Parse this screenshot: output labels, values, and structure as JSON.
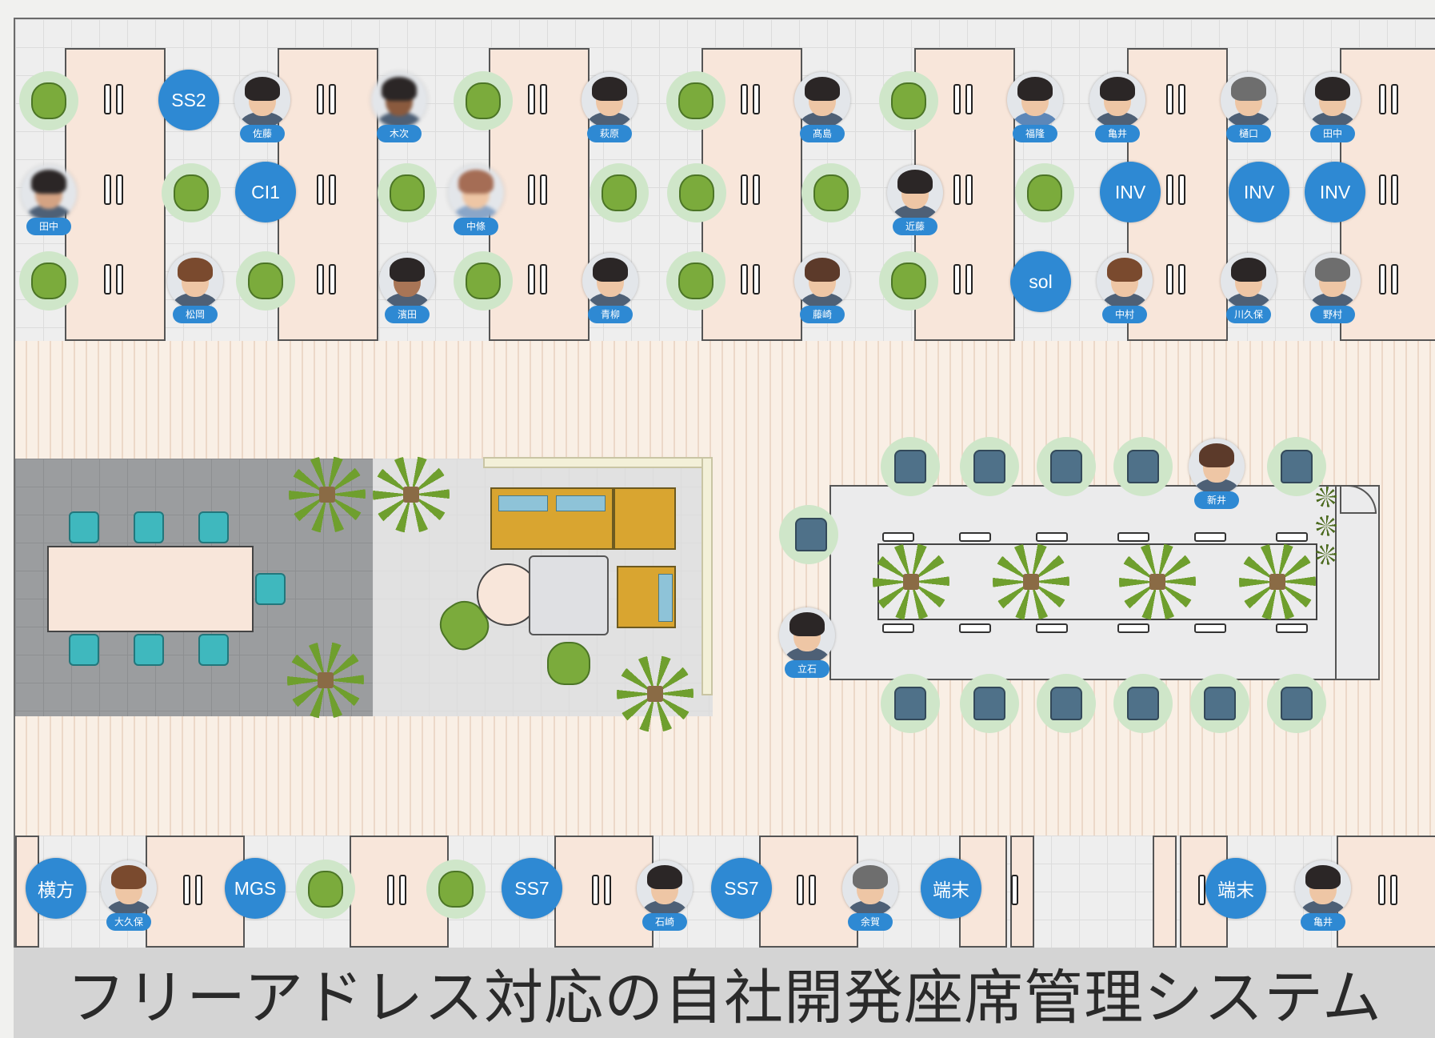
{
  "caption": "フリーアドレス対応の自社開発座席管理システム",
  "colors": {
    "badge": "#2e89d3",
    "desk": "#f8e6da",
    "vacant_seat": "#7bab3c",
    "floor": "#f7ece2"
  },
  "top_row": {
    "seats": [
      {
        "row": 0,
        "kind": "vacant"
      },
      {
        "row": 0,
        "kind": "badge",
        "label": "SS2"
      },
      {
        "row": 0,
        "kind": "person",
        "name": "佐藤"
      },
      {
        "row": 0,
        "kind": "person",
        "name": "木次"
      },
      {
        "row": 0,
        "kind": "vacant"
      },
      {
        "row": 0,
        "kind": "person",
        "name": "萩原"
      },
      {
        "row": 0,
        "kind": "vacant"
      },
      {
        "row": 0,
        "kind": "person",
        "name": "髙島"
      },
      {
        "row": 0,
        "kind": "vacant"
      },
      {
        "row": 0,
        "kind": "person",
        "name": "福隆"
      },
      {
        "row": 0,
        "kind": "person",
        "name": "亀井"
      },
      {
        "row": 0,
        "kind": "person",
        "name": "樋口"
      },
      {
        "row": 0,
        "kind": "person",
        "name": "田中"
      },
      {
        "row": 1,
        "kind": "person",
        "name": "田中"
      },
      {
        "row": 1,
        "kind": "vacant"
      },
      {
        "row": 1,
        "kind": "badge",
        "label": "CI1"
      },
      {
        "row": 1,
        "kind": "vacant"
      },
      {
        "row": 1,
        "kind": "person",
        "name": "中條"
      },
      {
        "row": 1,
        "kind": "vacant"
      },
      {
        "row": 1,
        "kind": "vacant"
      },
      {
        "row": 1,
        "kind": "vacant"
      },
      {
        "row": 1,
        "kind": "person",
        "name": "近藤"
      },
      {
        "row": 1,
        "kind": "vacant"
      },
      {
        "row": 1,
        "kind": "badge",
        "label": "INV"
      },
      {
        "row": 1,
        "kind": "badge",
        "label": "INV"
      },
      {
        "row": 1,
        "kind": "badge",
        "label": "INV"
      },
      {
        "row": 2,
        "kind": "vacant"
      },
      {
        "row": 2,
        "kind": "person",
        "name": "松岡"
      },
      {
        "row": 2,
        "kind": "vacant"
      },
      {
        "row": 2,
        "kind": "person",
        "name": "濱田"
      },
      {
        "row": 2,
        "kind": "vacant"
      },
      {
        "row": 2,
        "kind": "person",
        "name": "青柳"
      },
      {
        "row": 2,
        "kind": "vacant"
      },
      {
        "row": 2,
        "kind": "person",
        "name": "藤崎"
      },
      {
        "row": 2,
        "kind": "vacant"
      },
      {
        "row": 2,
        "kind": "badge",
        "label": "sol"
      },
      {
        "row": 2,
        "kind": "person",
        "name": "中村"
      },
      {
        "row": 2,
        "kind": "person",
        "name": "川久保"
      },
      {
        "row": 2,
        "kind": "person",
        "name": "野村"
      }
    ]
  },
  "bottom_row": {
    "seats": [
      {
        "kind": "badge",
        "label": "横方"
      },
      {
        "kind": "person",
        "name": "大久保"
      },
      {
        "kind": "badge",
        "label": "MGS"
      },
      {
        "kind": "vacant"
      },
      {
        "kind": "vacant"
      },
      {
        "kind": "badge",
        "label": "SS7"
      },
      {
        "kind": "person",
        "name": "石崎"
      },
      {
        "kind": "badge",
        "label": "SS7"
      },
      {
        "kind": "person",
        "name": "余賀"
      },
      {
        "kind": "badge",
        "label": "端末"
      },
      {
        "kind": "badge",
        "label": "端末"
      },
      {
        "kind": "person",
        "name": "亀井"
      }
    ]
  },
  "lounge_table": {
    "people": [
      {
        "name": "新井"
      },
      {
        "name": "立石"
      }
    ]
  }
}
